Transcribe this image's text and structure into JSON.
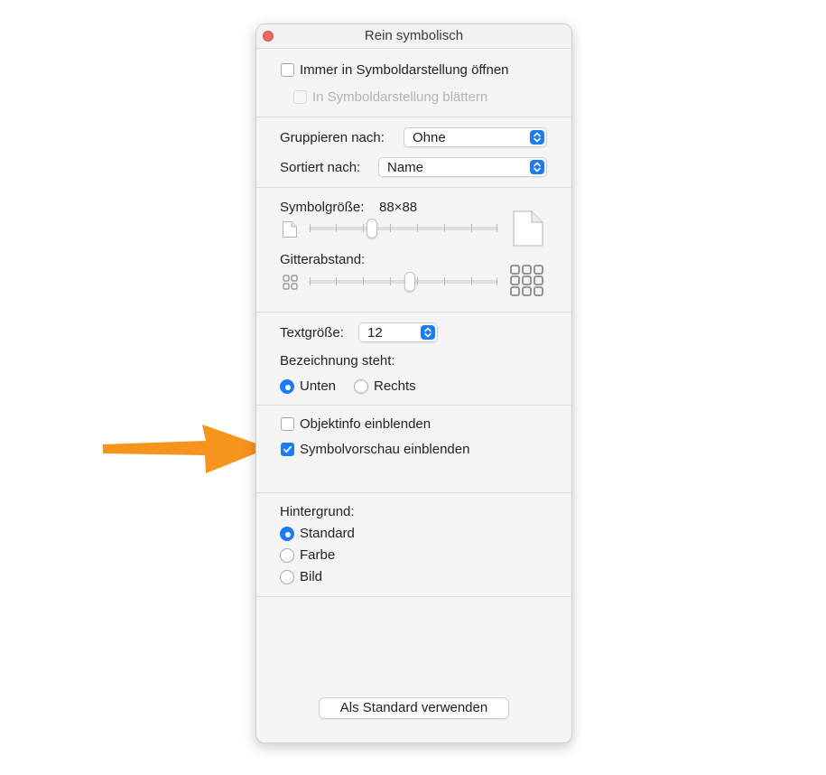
{
  "window": {
    "title": "Rein symbolisch"
  },
  "view_options": {
    "always_open_icon_view": {
      "label": "Immer in Symboldarstellung öffnen",
      "checked": false
    },
    "browse_icon_view": {
      "label": "In Symboldarstellung blättern",
      "checked": false,
      "enabled": false
    }
  },
  "grouping": {
    "group_by": {
      "label": "Gruppieren nach:",
      "value": "Ohne"
    },
    "sort_by": {
      "label": "Sortiert nach:",
      "value": "Name"
    }
  },
  "sizes": {
    "icon_size": {
      "label": "Symbolgröße:",
      "value": "88×88",
      "slider_fraction": 0.29
    },
    "grid_spacing": {
      "label": "Gitterabstand:",
      "slider_fraction": 0.53
    }
  },
  "text": {
    "text_size": {
      "label": "Textgröße:",
      "value": "12"
    },
    "label_position": {
      "label": "Bezeichnung steht:",
      "options": [
        "Unten",
        "Rechts"
      ],
      "selected": "Unten"
    }
  },
  "info": {
    "show_item_info": {
      "label": "Objektinfo einblenden",
      "checked": false
    },
    "show_icon_preview": {
      "label": "Symbolvorschau einblenden",
      "checked": true
    }
  },
  "background": {
    "label": "Hintergrund:",
    "options": [
      "Standard",
      "Farbe",
      "Bild"
    ],
    "selected": "Standard"
  },
  "footer": {
    "use_as_defaults": "Als Standard verwenden"
  },
  "colors": {
    "accent": "#1b7cf5",
    "arrow": "#f7941d",
    "close": "#ed6a5e"
  }
}
